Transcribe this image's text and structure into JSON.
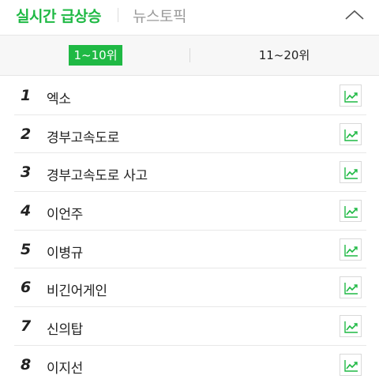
{
  "header": {
    "main_tab": "실시간 급상승",
    "news_tab": "뉴스토픽",
    "collapse_icon": "chevron-up-icon"
  },
  "rank_tabs": {
    "first": "1~10위",
    "second": "11~20위"
  },
  "items": [
    {
      "rank": "1",
      "keyword": "엑소"
    },
    {
      "rank": "2",
      "keyword": "경부고속도로"
    },
    {
      "rank": "3",
      "keyword": "경부고속도로 사고"
    },
    {
      "rank": "4",
      "keyword": "이언주"
    },
    {
      "rank": "5",
      "keyword": "이병규"
    },
    {
      "rank": "6",
      "keyword": "비긴어게인"
    },
    {
      "rank": "7",
      "keyword": "신의탑"
    },
    {
      "rank": "8",
      "keyword": "이지선"
    }
  ],
  "trend_icon": "trend-chart-icon",
  "colors": {
    "accent": "#1fb944",
    "text": "#222222",
    "muted": "#9a9a9a"
  }
}
